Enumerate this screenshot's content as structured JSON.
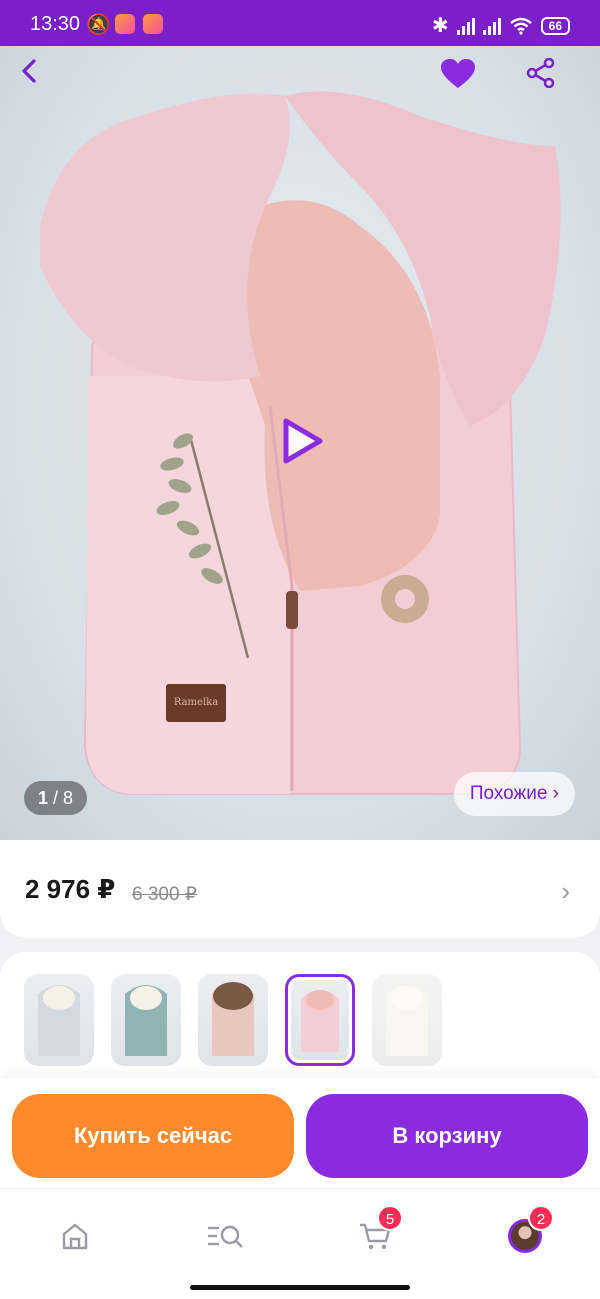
{
  "status_bar": {
    "time": "13:30",
    "mute_icon": "bell-off-icon",
    "battery": "66"
  },
  "product": {
    "image_counter_current": "1",
    "image_counter_total": "/ 8",
    "similar_label": "Похожие ›",
    "label_brand": "Ramelka",
    "price": "2 976 ₽",
    "old_price": "6 300 ₽"
  },
  "actions": {
    "buy_now": "Купить сейчас",
    "add_to_cart": "В корзину"
  },
  "tabbar": {
    "cart_badge": "5",
    "profile_badge": "2"
  },
  "colors": {
    "brand": "#7a1fc9",
    "accent_orange": "#ff8a2c",
    "accent_purple": "#8a2be2",
    "badge": "#ff2d55"
  },
  "icons": {
    "back": "back-arrow-icon",
    "favorite": "heart-icon",
    "share": "share-icon",
    "play": "play-icon",
    "home": "home-icon",
    "catalog": "catalog-search-icon",
    "cart": "cart-icon",
    "profile": "avatar"
  }
}
